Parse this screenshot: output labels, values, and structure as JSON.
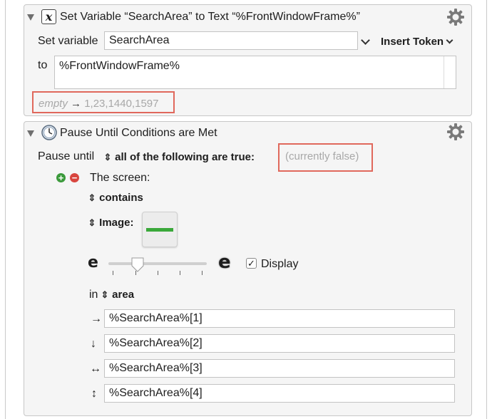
{
  "action1": {
    "icon": "x-variable-icon",
    "title": "Set Variable “SearchArea” to Text “%FrontWindowFrame%”",
    "set_variable_label": "Set variable",
    "variable_name": "SearchArea",
    "insert_token_label": "Insert Token",
    "to_label": "to",
    "text_value": "%FrontWindowFrame%",
    "preview_empty": "empty",
    "preview_arrow": "→",
    "preview_value": "1,23,1440,1597"
  },
  "action2": {
    "icon": "clock-icon",
    "title": "Pause Until Conditions are Met",
    "pause_until_label": "Pause until",
    "condition_mode": "all of the following are true:",
    "status": "(currently false)",
    "condition": {
      "subject": "The screen:",
      "operator": "contains",
      "image_label": "Image:",
      "fuzz_left_glyph": "e",
      "fuzz_right_glyph": "e",
      "fuzz_level": 0.3,
      "display_checked": true,
      "display_label": "Display",
      "in_label": "in",
      "area_label": "area",
      "coords": [
        {
          "arrow": "→",
          "value": "%SearchArea%[1]"
        },
        {
          "arrow": "↓",
          "value": "%SearchArea%[2]"
        },
        {
          "arrow": "↔",
          "value": "%SearchArea%[3]"
        },
        {
          "arrow": "↕",
          "value": "%SearchArea%[4]"
        }
      ]
    }
  },
  "colors": {
    "highlight": "#e0685c",
    "add": "#3b9a3b",
    "remove": "#d8453e",
    "panel": "#f5f5f5",
    "placeholder": "#a8a8a8"
  }
}
